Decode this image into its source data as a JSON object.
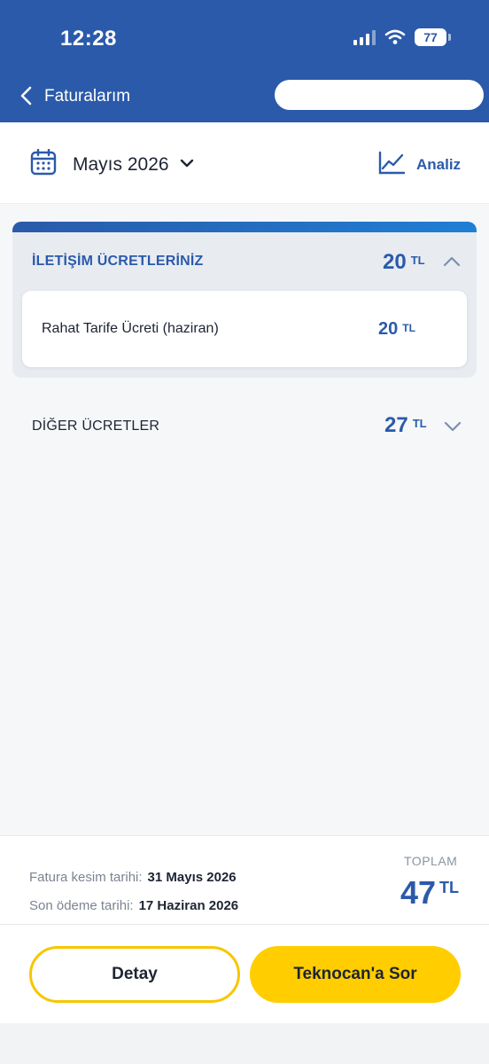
{
  "status_bar": {
    "time": "12:28",
    "battery": "77"
  },
  "nav": {
    "title": "Faturalarım"
  },
  "month_bar": {
    "month": "Mayıs 2026",
    "analysis_label": "Analiz"
  },
  "sections": [
    {
      "title": "İLETİŞİM ÜCRETLERİNİZ",
      "amount": "20",
      "currency": "TL",
      "expanded": true,
      "items": [
        {
          "label": "Rahat Tarife Ücreti (haziran)",
          "amount": "20",
          "currency": "TL"
        }
      ]
    },
    {
      "title": "DİĞER ÜCRETLER",
      "amount": "27",
      "currency": "TL",
      "expanded": false
    }
  ],
  "footer": {
    "cut_date_label": "Fatura kesim tarihi:",
    "cut_date": "31 Mayıs 2026",
    "due_date_label": "Son ödeme tarihi:",
    "due_date": "17 Haziran 2026",
    "total_label": "TOPLAM",
    "total_amount": "47",
    "total_currency": "TL",
    "detail_button": "Detay",
    "ask_button": "Teknocan'a Sor"
  },
  "colors": {
    "primary": "#2b5aaa",
    "accent_yellow": "#ffcd00",
    "background": "#f6f7f9"
  }
}
